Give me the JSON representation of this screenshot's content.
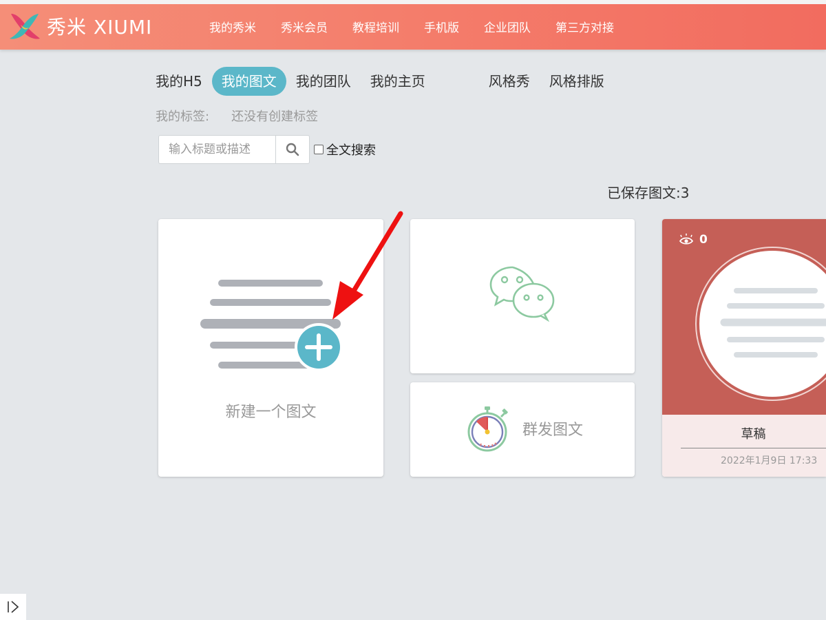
{
  "header": {
    "logo_text": "秀米 XIUMI",
    "nav": [
      "我的秀米",
      "秀米会员",
      "教程培训",
      "手机版",
      "企业团队",
      "第三方对接"
    ]
  },
  "tabs": {
    "left": [
      "我的H5",
      "我的图文",
      "我的团队",
      "我的主页"
    ],
    "right": [
      "风格秀",
      "风格排版"
    ],
    "active": "我的图文"
  },
  "tags": {
    "label": "我的标签:",
    "empty_text": "还没有创建标签"
  },
  "search": {
    "placeholder": "输入标题或描述",
    "fulltext_label": "全文搜索",
    "fulltext_checked": false
  },
  "saved_count_text": "已保存图文:3",
  "cards": {
    "new_label": "新建一个图文",
    "mass_label": "群发图文",
    "draft": {
      "views": "0",
      "title": "草稿",
      "date": "2022年1月9日 17:33"
    }
  },
  "colors": {
    "header_gradient_start": "#f58e78",
    "header_gradient_end": "#f26c5f",
    "tab_active": "#5bb7c9",
    "draft_bg": "#c55f57",
    "wechat_icon": "#8cc9a0",
    "annotation_arrow": "#ee1111"
  }
}
